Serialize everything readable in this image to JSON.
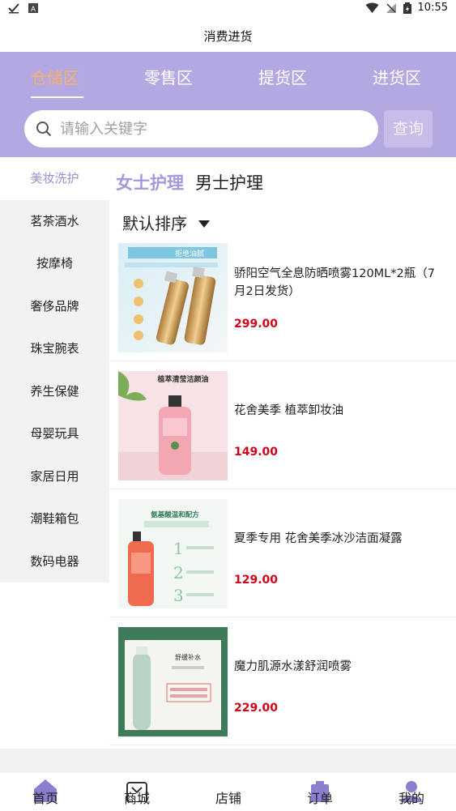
{
  "status_bar": {
    "time": "10:55"
  },
  "title": "消费进货",
  "tabs": [
    {
      "label": "仓储区"
    },
    {
      "label": "零售区"
    },
    {
      "label": "提货区"
    },
    {
      "label": "进货区"
    }
  ],
  "search": {
    "placeholder": "请输入关键字",
    "button_label": "查询"
  },
  "sidebar": {
    "items": [
      {
        "label": "美妆洗护"
      },
      {
        "label": "茗茶酒水"
      },
      {
        "label": "按摩椅"
      },
      {
        "label": "奢侈品牌"
      },
      {
        "label": "珠宝腕表"
      },
      {
        "label": "养生保健"
      },
      {
        "label": "母婴玩具"
      },
      {
        "label": "家居日用"
      },
      {
        "label": "潮鞋箱包"
      },
      {
        "label": "数码电器"
      }
    ]
  },
  "subtabs": [
    {
      "label": "女士护理"
    },
    {
      "label": "男士护理"
    }
  ],
  "sort": {
    "label": "默认排序"
  },
  "products": [
    {
      "name": "骄阳空气全息防晒喷雾120ML*2瓶（7月2日发货）",
      "price": "299.00",
      "image_text": "拒绝油腻"
    },
    {
      "name": "花舍美季 植萃卸妆油",
      "price": "149.00",
      "image_text": "植萃清莹洁颜油"
    },
    {
      "name": "夏季专用 花舍美季冰沙洁面凝露",
      "price": "129.00",
      "image_text": "氨基酸温和配方"
    },
    {
      "name": "魔力肌源水漾舒润喷雾",
      "price": "229.00",
      "image_text": "舒缓补水"
    }
  ],
  "bottom_nav": [
    {
      "label": "首页",
      "icon": "home-icon"
    },
    {
      "label": "商城",
      "icon": "shop-icon"
    },
    {
      "label": "店铺",
      "icon": "store-icon"
    },
    {
      "label": "订单",
      "icon": "order-icon"
    },
    {
      "label": "我的",
      "icon": "user-icon"
    }
  ],
  "colors": {
    "header_bg": "#b4a8e2",
    "active_tab": "#f5b26b",
    "accent": "#a797dc",
    "price": "#d0021b"
  }
}
